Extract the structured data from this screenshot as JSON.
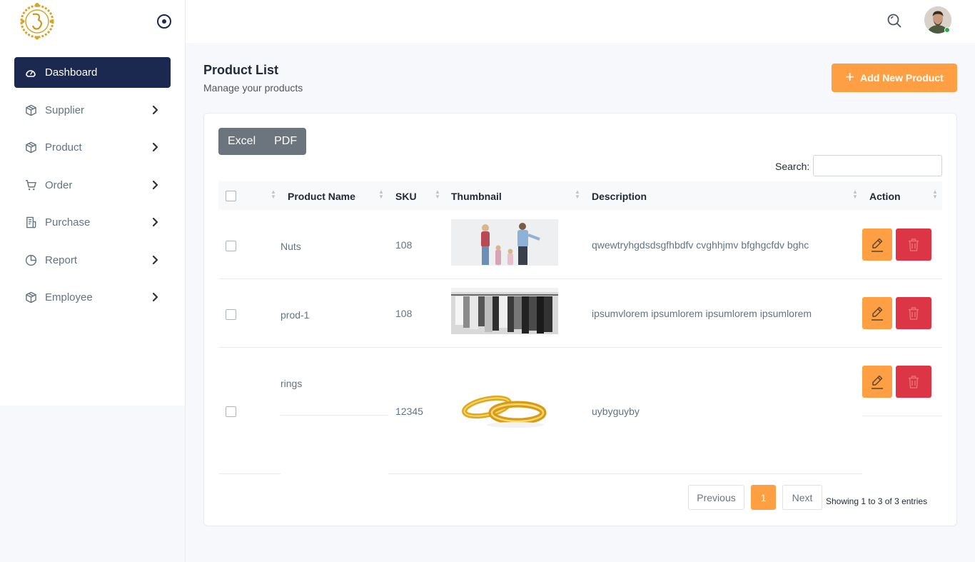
{
  "sidebar": {
    "items": [
      {
        "label": "Dashboard",
        "icon": "dashboard-icon",
        "active": true
      },
      {
        "label": "Supplier",
        "icon": "box-icon"
      },
      {
        "label": "Product",
        "icon": "box-icon"
      },
      {
        "label": "Order",
        "icon": "cart-icon"
      },
      {
        "label": "Purchase",
        "icon": "receipt-icon"
      },
      {
        "label": "Report",
        "icon": "pie-chart-icon"
      },
      {
        "label": "Employee",
        "icon": "box-icon"
      }
    ]
  },
  "page": {
    "title": "Product List",
    "subtitle": "Manage your products",
    "add_label": "Add New Product"
  },
  "toolbar": {
    "excel_label": "Excel",
    "pdf_label": "PDF",
    "search_label": "Search:",
    "search_value": ""
  },
  "table": {
    "headers": [
      "Product Name",
      "SKU",
      "Thumbnail",
      "Description",
      "Action"
    ],
    "rows": [
      {
        "name": "Nuts",
        "sku": "108",
        "thumbnail": "family photo",
        "description": "qwewtryhgdsdsgfhbdfv cvghhjmv bfghgcfdv bghc"
      },
      {
        "name": "prod-1",
        "sku": "108",
        "thumbnail": "clothes rack photo",
        "description": "ipsumvlorem ipsumlorem ipsumlorem ipsumlorem"
      },
      {
        "name": "rings",
        "sku": "12345",
        "thumbnail": "gold rings photo",
        "description": "uybyguyby"
      }
    ]
  },
  "pagination": {
    "previous_label": "Previous",
    "current_page": "1",
    "next_label": "Next",
    "info": "Showing 1 to 3 of 3 entries"
  },
  "colors": {
    "primary": "#1b2850",
    "accent": "#ff9f43",
    "danger": "#dc3545",
    "secondary": "#6c757d"
  }
}
